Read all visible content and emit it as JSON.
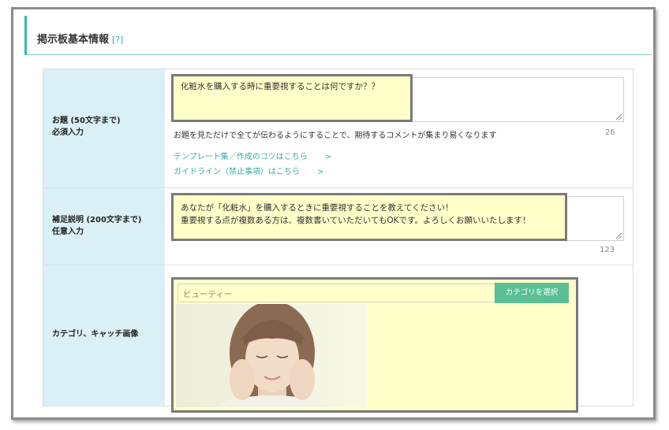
{
  "section": {
    "title": "掲示板基本情報",
    "help": "[?]"
  },
  "rows": {
    "topic": {
      "label_line1": "お題 (50文字まで)",
      "label_line2": "必須入力",
      "value": "化粧水を購入する時に重要視することは何ですか？？",
      "hint": "お題を見ただけで全てが伝わるようにすることで、期待するコメントが集まり易くなります",
      "count": "26",
      "link_template": "テンプレート集／作成のコツはこちら",
      "link_guideline": "ガイドライン（禁止事項）はこちら",
      "link_arrow": ">"
    },
    "description": {
      "label_line1": "補足説明 (200文字まで)",
      "label_line2": "任意入力",
      "value_line1": "あなたが「化粧水」を購入するときに重要視することを教えてください！",
      "value_line2": "重要視する点が複数ある方は、複数書いていただいてもOKです。よろしくお願いいたします！",
      "count": "123"
    },
    "category": {
      "label": "カテゴリ、キャッチ画像",
      "value": "ビューティー",
      "button": "カテゴリを選択"
    }
  },
  "colors": {
    "accent": "#38b7b0",
    "label_bg": "#dbeff6",
    "highlight": "#ffffc9",
    "button": "#5cbf93"
  }
}
